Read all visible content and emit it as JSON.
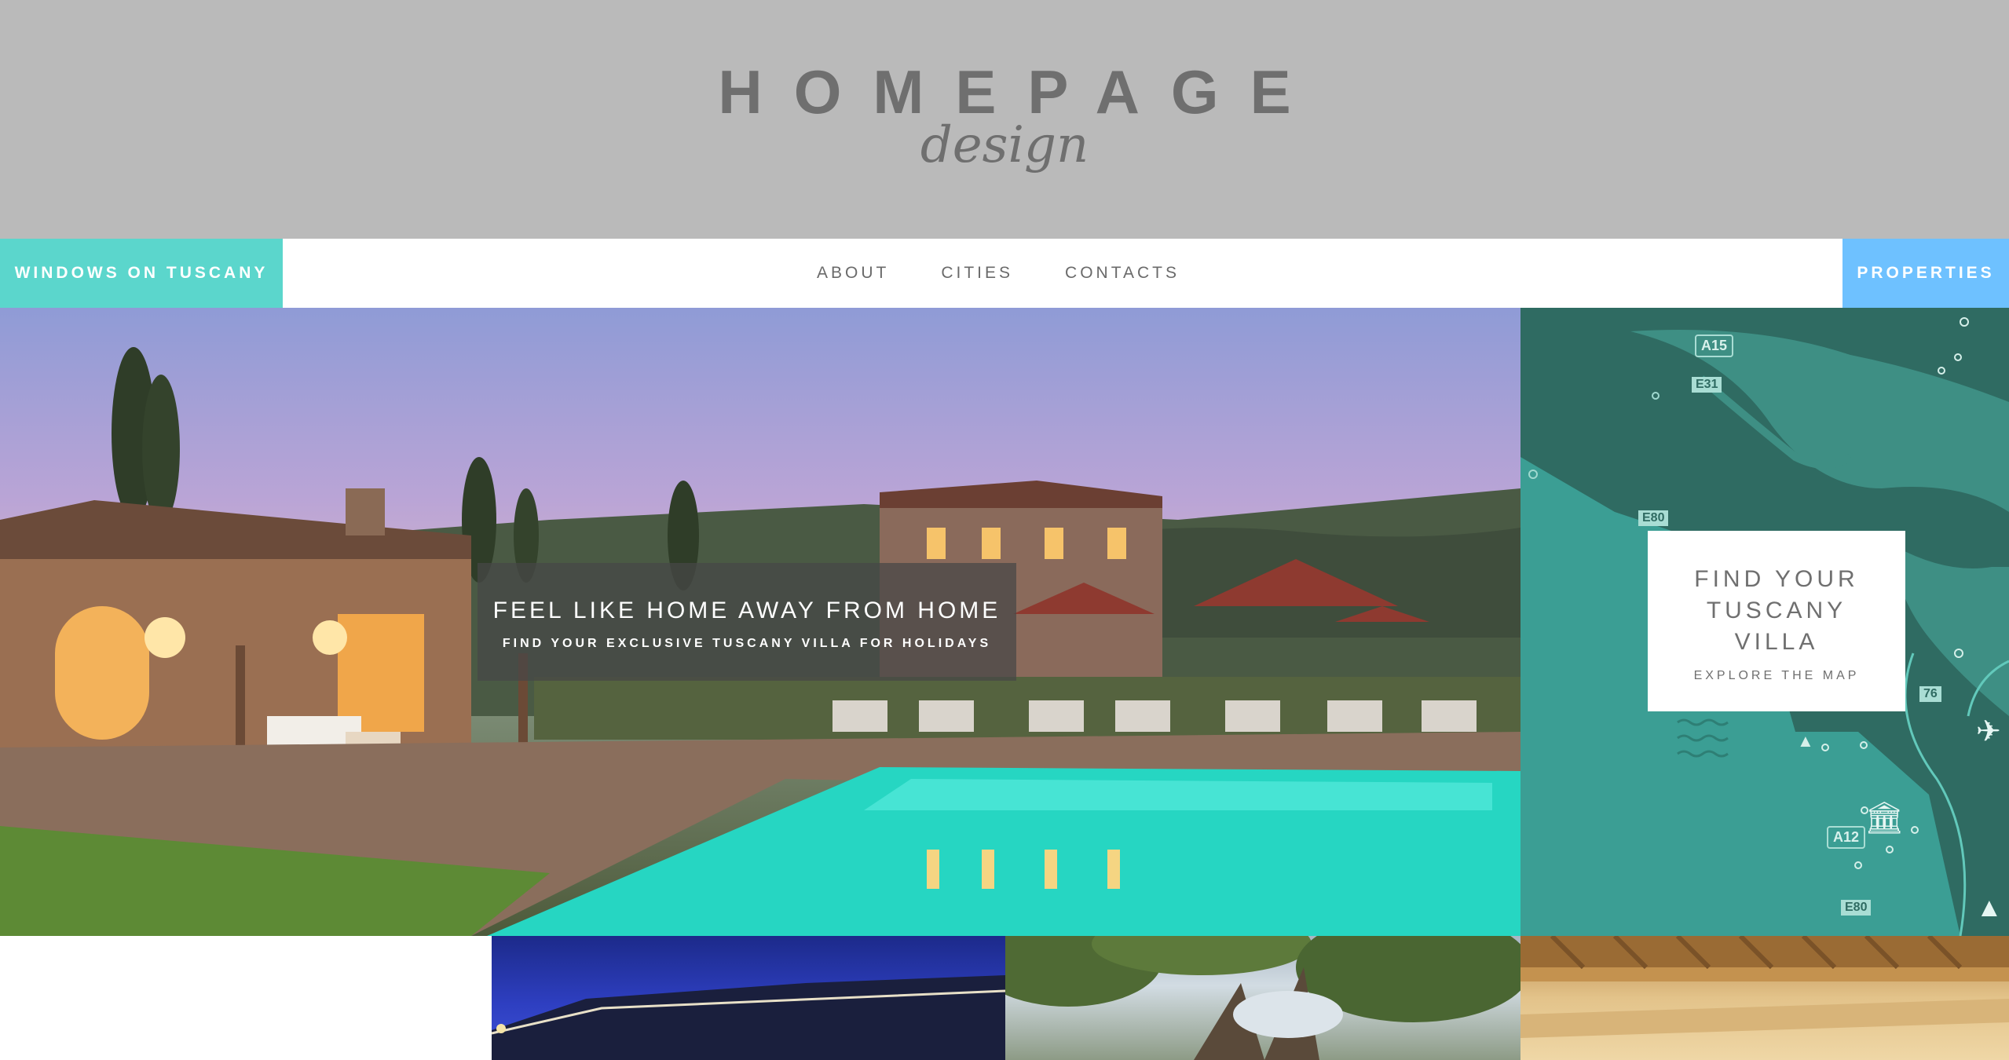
{
  "header": {
    "logo_word": "HOMEPAGE",
    "logo_sub": "design"
  },
  "nav": {
    "brand_label": "WINDOWS ON TUSCANY",
    "links": [
      "ABOUT",
      "CITIES",
      "CONTACTS"
    ],
    "properties_label": "PROPERTIES"
  },
  "hero": {
    "title": "FEEL LIKE HOME AWAY FROM HOME",
    "subtitle": "FIND YOUR EXCLUSIVE TUSCANY VILLA FOR HOLIDAYS",
    "image": "tuscany-villa-pool-dusk-photo"
  },
  "map": {
    "card_title": "FIND YOUR TUSCANY VILLA",
    "card_link": "EXPLORE THE MAP",
    "road_labels": [
      "A15",
      "E31",
      "E80",
      "A12",
      "E80",
      "76"
    ],
    "icons": [
      "museum-icon",
      "airplane-icon",
      "tree-icon",
      "waves-icon",
      "mountain-icon"
    ]
  },
  "tiles": [
    {
      "image": "night-building-photo"
    },
    {
      "image": "tree-canopy-photo"
    },
    {
      "image": "wood-beam-ceiling-photo"
    }
  ],
  "colors": {
    "header_bg": "#bababa",
    "brand_teal": "#5bd6cc",
    "properties_blue": "#6ec1ff",
    "map_teal": "#3b9e94",
    "text_grey": "#6f6f6f"
  }
}
